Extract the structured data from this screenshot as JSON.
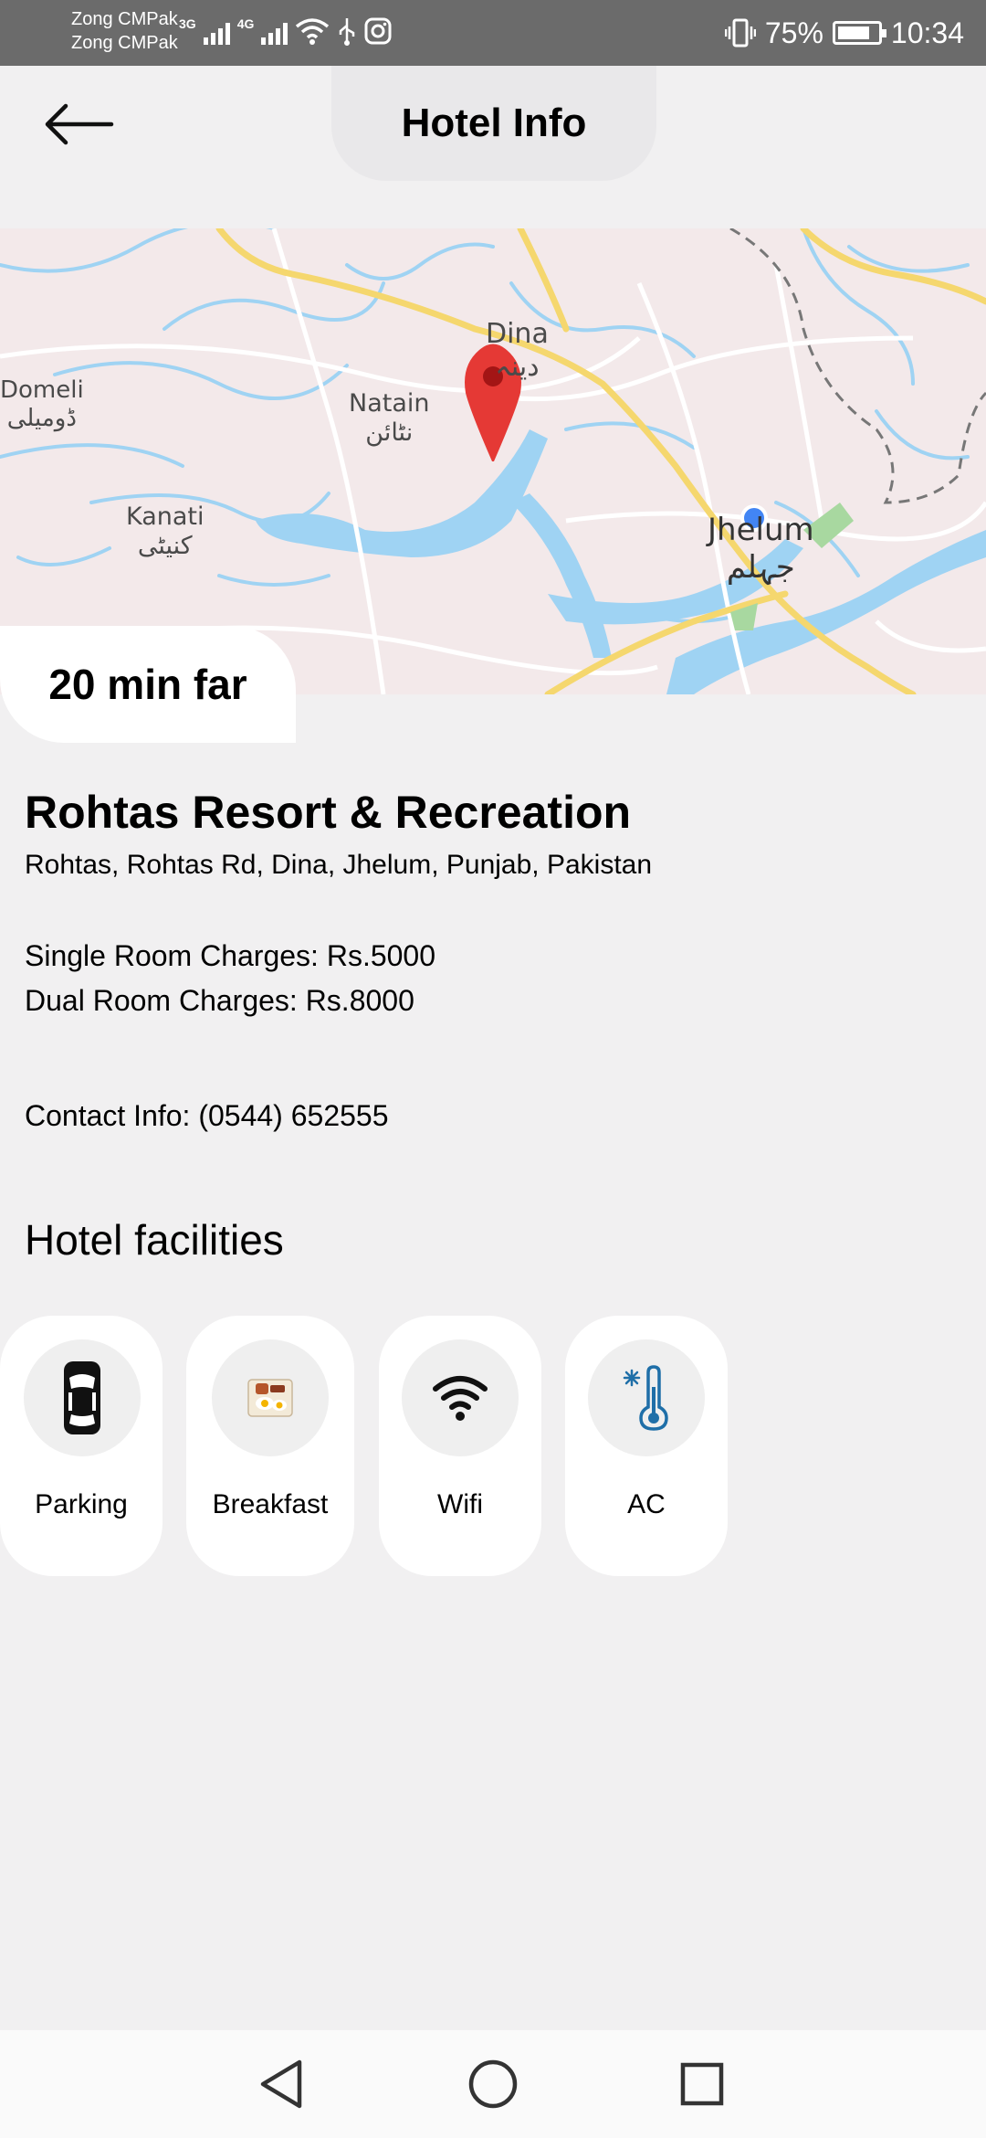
{
  "status_bar": {
    "carrier_1": "Zong CMPak",
    "carrier_2": "Zong CMPak",
    "network_1": "3G",
    "network_2": "4G",
    "battery_percent": "75%",
    "time": "10:34"
  },
  "header": {
    "title": "Hotel Info",
    "back_icon": "arrow-left-icon"
  },
  "map": {
    "labels": {
      "dina": "Dina",
      "dina_ur": "دینہ",
      "domeli": "Domeli",
      "domeli_ur": "ڈومیلی",
      "natain": "Natain",
      "natain_ur": "نٹائن",
      "kanati": "Kanati",
      "kanati_ur": "کنیٹی",
      "jhelum": "Jhelum",
      "jhelum_ur": "جہلم"
    },
    "pin_color": "#e53935",
    "location_dot_color": "#4285f4"
  },
  "travel_time": "20 min far",
  "hotel": {
    "name": "Rohtas Resort & Recreation",
    "address": "Rohtas, Rohtas Rd, Dina, Jhelum, Punjab, Pakistan",
    "single_room": "Single Room Charges: Rs.5000",
    "dual_room": "Dual Room Charges: Rs.8000",
    "contact": "Contact Info: (0544) 652555"
  },
  "facilities": {
    "title": "Hotel facilities",
    "items": [
      {
        "label": "Parking",
        "icon": "car-icon"
      },
      {
        "label": "Breakfast",
        "icon": "breakfast-icon"
      },
      {
        "label": "Wifi",
        "icon": "wifi-icon"
      },
      {
        "label": "AC",
        "icon": "thermometer-snowflake-icon"
      }
    ]
  },
  "nav_bar": {
    "back_icon": "triangle-back-icon",
    "home_icon": "circle-home-icon",
    "recents_icon": "square-recents-icon"
  }
}
